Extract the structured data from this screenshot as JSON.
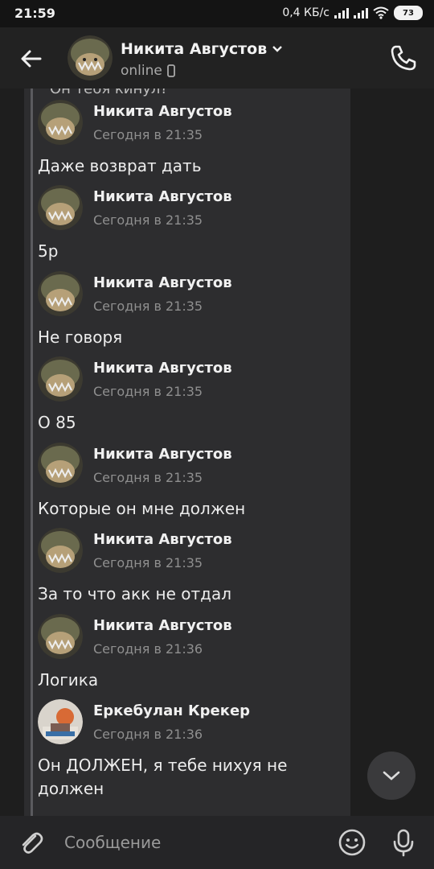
{
  "statusbar": {
    "time": "21:59",
    "net_speed": "0,4 КБ/с",
    "battery": "73"
  },
  "header": {
    "name": "Никита Августов",
    "status": "online"
  },
  "chat": {
    "partial_top_text": "Он тебя кинул?",
    "messages": [
      {
        "author": "Никита Августов",
        "time": "Сегодня в 21:35",
        "text": "Даже возврат дать",
        "avatar": "cat-avatar"
      },
      {
        "author": "Никита Августов",
        "time": "Сегодня в 21:35",
        "text": "5р",
        "avatar": "cat-avatar"
      },
      {
        "author": "Никита Августов",
        "time": "Сегодня в 21:35",
        "text": "Не говоря",
        "avatar": "cat-avatar"
      },
      {
        "author": "Никита Августов",
        "time": "Сегодня в 21:35",
        "text": "О 85",
        "avatar": "cat-avatar"
      },
      {
        "author": "Никита Августов",
        "time": "Сегодня в 21:35",
        "text": "Которые он мне должен",
        "avatar": "cat-avatar"
      },
      {
        "author": "Никита Августов",
        "time": "Сегодня в 21:35",
        "text": "За то что акк не отдал",
        "avatar": "cat-avatar"
      },
      {
        "author": "Никита Августов",
        "time": "Сегодня в 21:36",
        "text": "Логика",
        "avatar": "cat-avatar"
      },
      {
        "author": "Еркебулан Крекер",
        "time": "Сегодня в 21:36",
        "text": "Он ДОЛЖЕН, я тебе нихуя не должен",
        "avatar": "anime-avatar"
      }
    ]
  },
  "composer": {
    "placeholder": "Сообщение"
  }
}
